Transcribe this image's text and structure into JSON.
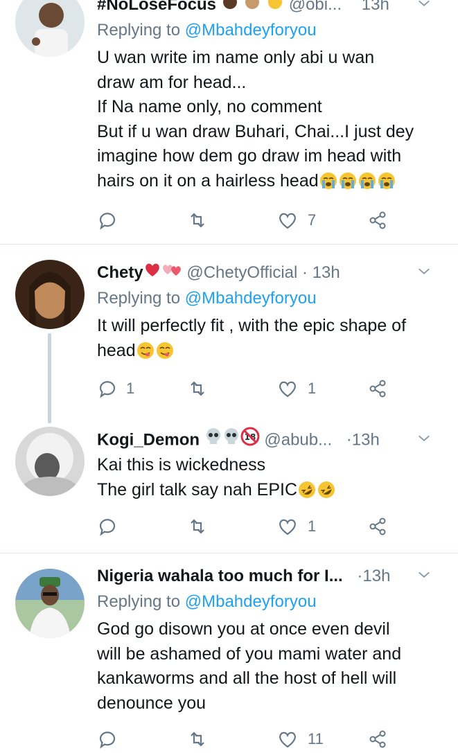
{
  "tweets": [
    {
      "name": "#NoLoseFocus",
      "handle": "@obi...",
      "time": "13h",
      "reply_label": "Replying to",
      "reply_to": "@Mbahdeyforyou",
      "text": "U wan write im name only abi u wan\ndraw am for head...\nIf Na name only, no comment\nBut if u wan draw Buhari, Chai...I just dey\nimagine how dem go draw im head with\nhairs on it on a hairless head",
      "emojis": [
        "loudly-crying-face",
        "loudly-crying-face",
        "loudly-crying-face",
        "loudly-crying-face"
      ],
      "replies": "",
      "retweets": "",
      "likes": "7"
    },
    {
      "name": "Chety",
      "handle": "@ChetyOfficial",
      "dot": "·",
      "time": "13h",
      "reply_label": "Replying to",
      "reply_to": "@Mbahdeyforyou",
      "text": "It will perfectly fit , with the epic shape of\nhead",
      "emojis": [
        "face-savoring-food",
        "face-savoring-food"
      ],
      "replies": "1",
      "retweets": "",
      "likes": "1"
    },
    {
      "name": "Kogi_Demon",
      "handle": "@abub...",
      "dot": "·",
      "time": "13h",
      "text": "Kai this is wickedness\nThe girl talk say nah EPIC",
      "emojis": [
        "rolling-laughing-face",
        "rolling-laughing-face"
      ],
      "replies": "",
      "retweets": "",
      "likes": "1"
    },
    {
      "name": "Nigeria wahala too much for I...",
      "dot": "·",
      "time": "13h",
      "reply_label": "Replying to",
      "reply_to": "@Mbahdeyforyou",
      "text": "God go disown you at once even devil\nwill be ashamed of you mami water and\nkankaworms and all the host of hell will\ndenounce you",
      "replies": "",
      "retweets": "",
      "likes": "11"
    }
  ],
  "colors": {
    "link": "#1da1f2",
    "muted": "#657786",
    "text": "#14171a",
    "divider": "#e1e8ed"
  }
}
